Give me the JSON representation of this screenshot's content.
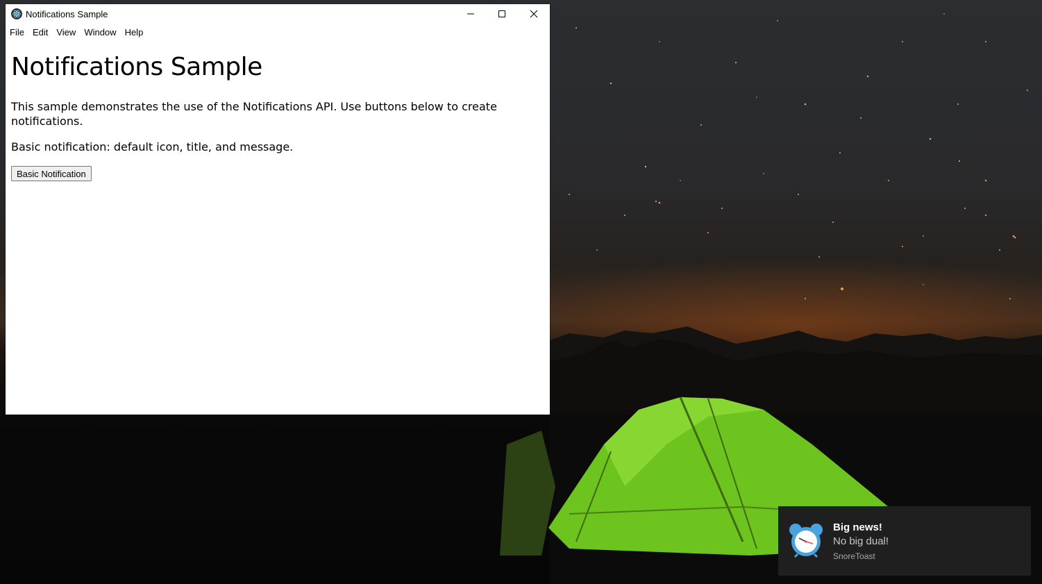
{
  "window": {
    "title": "Notifications Sample",
    "icon": "electron-icon"
  },
  "menubar": {
    "items": [
      "File",
      "Edit",
      "View",
      "Window",
      "Help"
    ]
  },
  "main": {
    "heading": "Notifications Sample",
    "intro": "This sample demonstrates the use of the Notifications API. Use buttons below to create notifications.",
    "basic_description": "Basic notification: default icon, title, and message.",
    "basic_button_label": "Basic Notification"
  },
  "toast": {
    "title": "Big news!",
    "message": "No big dual!",
    "source": "SnoreToast",
    "icon": "alarm-clock-icon",
    "background": "#1f1f1f"
  },
  "desktop": {
    "wallpaper": "night sky with green tent"
  }
}
